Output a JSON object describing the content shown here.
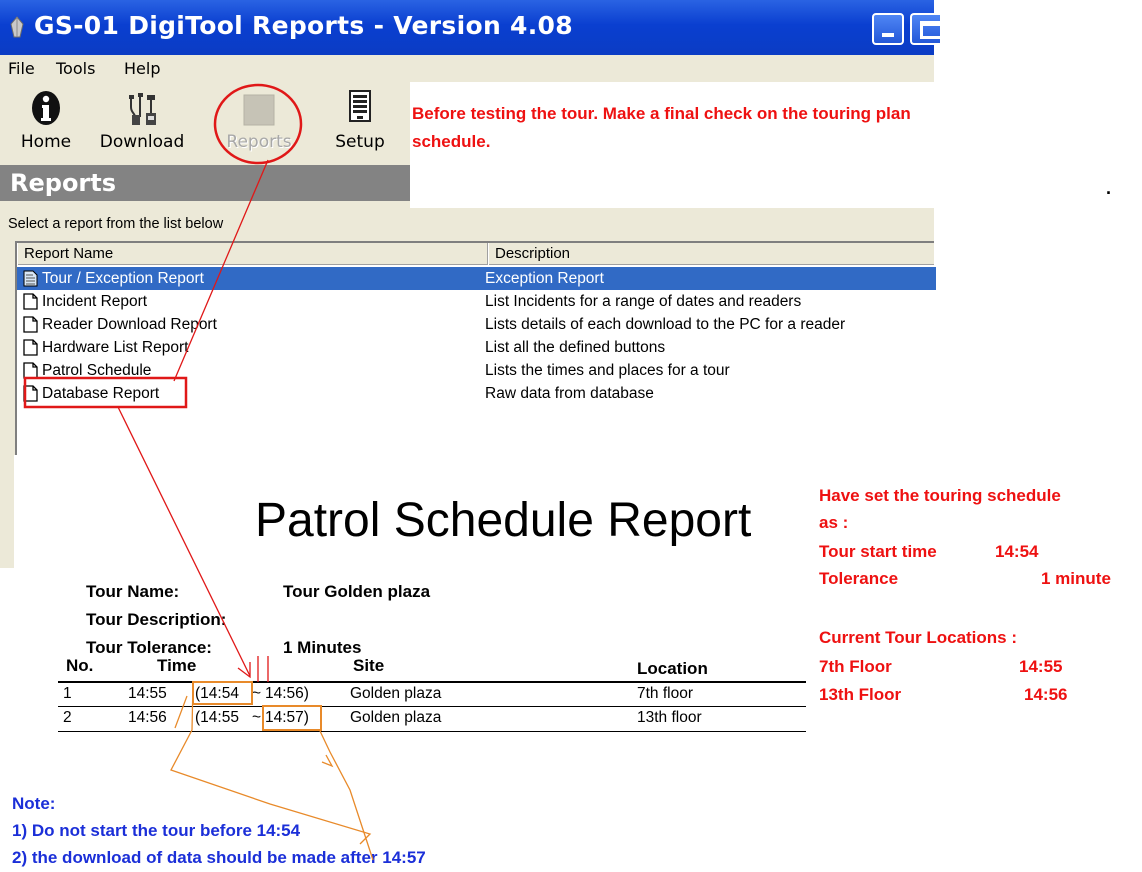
{
  "window": {
    "title": "GS-01 DigiTool Reports - Version 4.08"
  },
  "menu": [
    {
      "label": "File"
    },
    {
      "label": "Tools"
    },
    {
      "label": "Help"
    }
  ],
  "toolbar": {
    "home_label": "Home",
    "download_label": "Download",
    "reports_label": "Reports",
    "setup_label": "Setup"
  },
  "section": {
    "title": "Reports",
    "prompt": "Select a report from the list below"
  },
  "report_list": {
    "columns": [
      "Report Name",
      "Description"
    ],
    "rows": [
      {
        "name": "Tour / Exception Report",
        "description": "Exception Report",
        "selected": true
      },
      {
        "name": "Incident Report",
        "description": "List Incidents for a range of dates and readers"
      },
      {
        "name": "Reader Download Report",
        "description": "Lists details of each download to the PC for a reader"
      },
      {
        "name": "Hardware List Report",
        "description": "List all the defined buttons"
      },
      {
        "name": "Patrol Schedule",
        "description": "Lists the times and places for a tour"
      },
      {
        "name": "Database Report",
        "description": "Raw data from database"
      }
    ]
  },
  "report": {
    "title": "Patrol Schedule Report",
    "tour_name_label": "Tour Name:",
    "tour_name_value": "Tour  Golden plaza",
    "tour_description_label": "Tour Description:",
    "tour_tolerance_label": "Tour Tolerance:",
    "tour_tolerance_value": "1  Minutes",
    "columns": [
      "No.",
      "Time",
      "Site",
      "Location"
    ],
    "rows": [
      {
        "no": "1",
        "time": "14:55",
        "window_start": "(14:54",
        "tilde": "~",
        "window_end": "14:56)",
        "site": "Golden plaza",
        "location": "7th floor"
      },
      {
        "no": "2",
        "time": "14:56",
        "window_start": "(14:55",
        "tilde": "~",
        "window_end": "14:57)",
        "site": "Golden plaza",
        "location": "13th floor"
      }
    ]
  },
  "annotations": {
    "top_note_line1": "Before testing the tour. Make a final check on the touring plan",
    "top_note_line2": "schedule.",
    "stray_dot": ".",
    "side_note": {
      "line1": "Have set the touring schedule",
      "line2": "as :",
      "start_label": "Tour start time",
      "start_value": "14:54",
      "tolerance_label": "Tolerance",
      "tolerance_value": "1 minute",
      "locations_heading": "Current Tour Locations :",
      "loc1_label": "7th Floor",
      "loc1_value": "14:55",
      "loc2_label": "13th Floor",
      "loc2_value": "14:56"
    },
    "bottom_note": {
      "heading": "Note:",
      "item1": "1)  Do not start the tour before 14:54",
      "item2": "2) the download of data should be made after 14:57"
    }
  },
  "colors": {
    "titlebar": "#0b3cc4",
    "selection": "#316ac5",
    "annotation_red": "#ee1111",
    "annotation_blue": "#1b2fd8",
    "annotation_orange": "#e88a2a"
  }
}
